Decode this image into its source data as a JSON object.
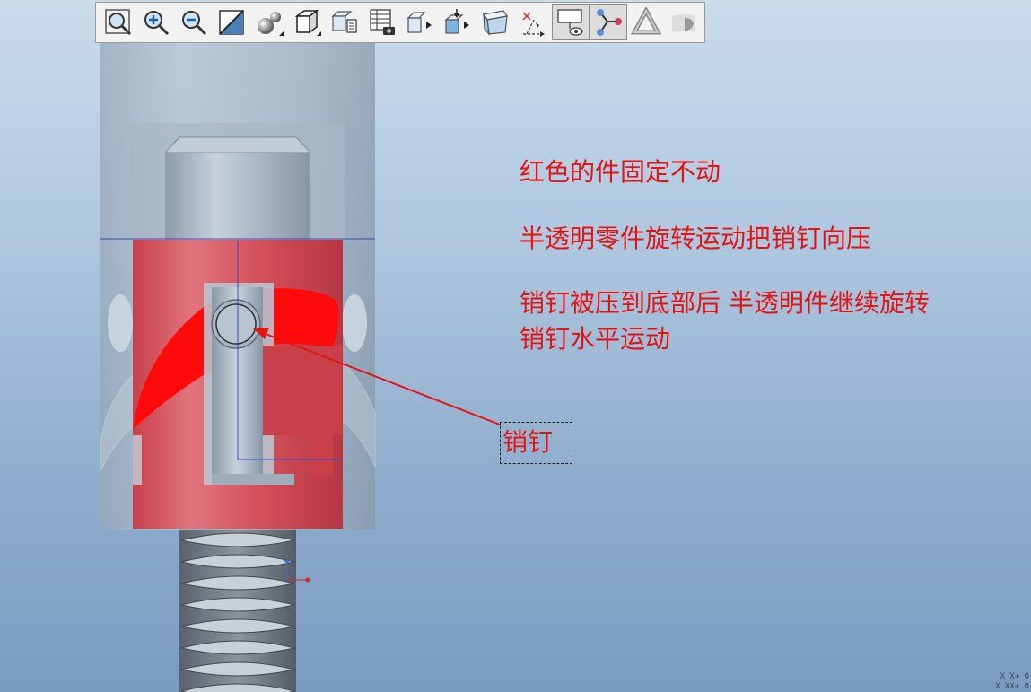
{
  "toolbar": {
    "buttons": [
      {
        "name": "refit-icon"
      },
      {
        "name": "zoom-in-icon"
      },
      {
        "name": "zoom-out-icon"
      },
      {
        "name": "repaint-icon"
      },
      {
        "name": "display-style-icon"
      },
      {
        "name": "shading-icon"
      },
      {
        "name": "saved-views-icon"
      },
      {
        "name": "view-manager-icon"
      },
      {
        "name": "orient-icon"
      },
      {
        "name": "spin-center-icon"
      },
      {
        "name": "perspective-icon"
      },
      {
        "name": "datum-display-icon"
      },
      {
        "name": "annotation-display-icon"
      },
      {
        "name": "connector-display-icon"
      },
      {
        "name": "appearance-icon"
      },
      {
        "name": "render-icon"
      }
    ]
  },
  "notes": {
    "line1": "红色的件固定不动",
    "line2": "半透明零件旋转运动把销钉向压",
    "line3a": "销钉被压到底部后  半透明件继续旋转",
    "line3b": "销钉水平运动"
  },
  "callout": {
    "label": "销钉"
  },
  "colors": {
    "annotation": "#e51414",
    "red_part": "#d9434e",
    "translucent_part": "#a9b7c6"
  },
  "coords": {
    "line1": "X X+ 0",
    "line2": "X XX+ 0"
  }
}
